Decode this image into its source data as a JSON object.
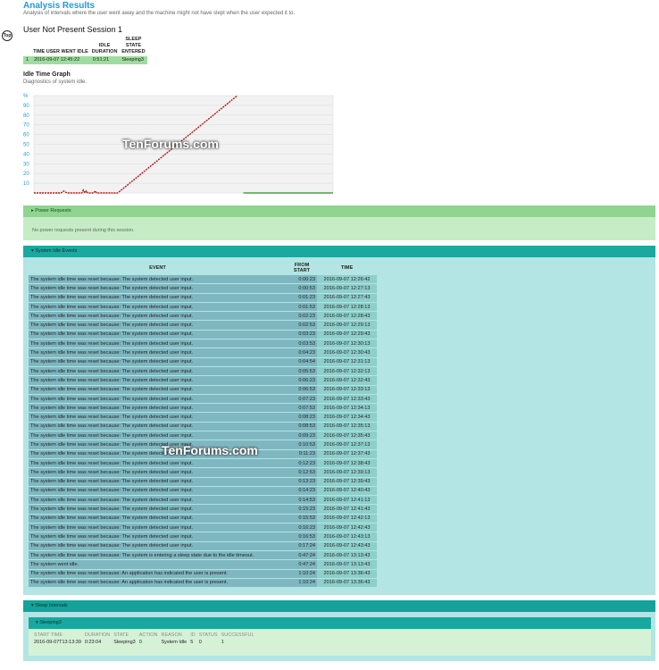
{
  "header": {
    "title": "Analysis Results",
    "subtitle": "Analysis of intervals where the user went away and the machine might not have slept when the user expected it to.",
    "top_button": "Top"
  },
  "session": {
    "title": "User Not Present Session 1",
    "columns": [
      "TIME USER WENT IDLE",
      "IDLE DURATION",
      "SLEEP STATE ENTERED"
    ],
    "row": {
      "index": "1",
      "time": "2016-09-07  12:45:22",
      "duration": "0:51:21",
      "state": "Sleeping3"
    }
  },
  "graph": {
    "title": "Idle Time Graph",
    "subtitle": "Diagnostics of system idle.",
    "y_unit": "%",
    "y_ticks": [
      "90",
      "80",
      "70",
      "60",
      "50",
      "40",
      "30",
      "20",
      "10"
    ]
  },
  "chart_data": {
    "type": "line",
    "ylim": [
      0,
      100
    ],
    "series": [
      {
        "values": [
          [
            0,
            0
          ],
          [
            5,
            0
          ],
          [
            9,
            0
          ],
          [
            10,
            2
          ],
          [
            11,
            0
          ],
          [
            16,
            0
          ],
          [
            16.5,
            3
          ],
          [
            17,
            0
          ],
          [
            17.5,
            2
          ],
          [
            18,
            0
          ],
          [
            20,
            0
          ],
          [
            20.5,
            2
          ],
          [
            21,
            0
          ],
          [
            28,
            0
          ],
          [
            68,
            100
          ]
        ]
      }
    ],
    "xlim": [
      0,
      100
    ],
    "colors": {
      "idle": "#b01818",
      "awake": "#2e8b2e"
    }
  },
  "power": {
    "header": "Power Requests",
    "message": "No power requests present during this session."
  },
  "idle_events": {
    "header": "System Idle Events",
    "columns": [
      "EVENT",
      "FROM START",
      "TIME"
    ],
    "rows": [
      [
        "The system idle time was reset because: The system detected user input.",
        "0:00:23",
        "2016-09-07  12:26:42"
      ],
      [
        "The system idle time was reset because: The system detected user input.",
        "0:00:53",
        "2016-09-07  12:27:13"
      ],
      [
        "The system idle time was reset because: The system detected user input.",
        "0:01:23",
        "2016-09-07  12:27:43"
      ],
      [
        "The system idle time was reset because: The system detected user input.",
        "0:01:53",
        "2016-09-07  12:28:13"
      ],
      [
        "The system idle time was reset because: The system detected user input.",
        "0:02:23",
        "2016-09-07  12:28:43"
      ],
      [
        "The system idle time was reset because: The system detected user input.",
        "0:02:53",
        "2016-09-07  12:29:13"
      ],
      [
        "The system idle time was reset because: The system detected user input.",
        "0:03:23",
        "2016-09-07  12:29:43"
      ],
      [
        "The system idle time was reset because: The system detected user input.",
        "0:03:53",
        "2016-09-07  12:30:13"
      ],
      [
        "The system idle time was reset because: The system detected user input.",
        "0:04:23",
        "2016-09-07  12:30:43"
      ],
      [
        "The system idle time was reset because: The system detected user input.",
        "0:04:54",
        "2016-09-07  12:31:13"
      ],
      [
        "The system idle time was reset because: The system detected user input.",
        "0:05:53",
        "2016-09-07  12:32:13"
      ],
      [
        "The system idle time was reset because: The system detected user input.",
        "0:06:23",
        "2016-09-07  12:32:43"
      ],
      [
        "The system idle time was reset because: The system detected user input.",
        "0:06:53",
        "2016-09-07  12:33:13"
      ],
      [
        "The system idle time was reset because: The system detected user input.",
        "0:07:23",
        "2016-09-07  12:33:43"
      ],
      [
        "The system idle time was reset because: The system detected user input.",
        "0:07:53",
        "2016-09-07  12:34:13"
      ],
      [
        "The system idle time was reset because: The system detected user input.",
        "0:08:23",
        "2016-09-07  12:34:43"
      ],
      [
        "The system idle time was reset because: The system detected user input.",
        "0:08:53",
        "2016-09-07  12:35:13"
      ],
      [
        "The system idle time was reset because: The system detected user input.",
        "0:09:23",
        "2016-09-07  12:35:43"
      ],
      [
        "The system idle time was reset because: The system detected user input.",
        "0:10:53",
        "2016-09-07  12:37:13"
      ],
      [
        "The system idle time was reset because: The system detected user input.",
        "0:11:23",
        "2016-09-07  12:37:43"
      ],
      [
        "The system idle time was reset because: The system detected user input.",
        "0:12:23",
        "2016-09-07  12:38:43"
      ],
      [
        "The system idle time was reset because: The system detected user input.",
        "0:12:53",
        "2016-09-07  12:39:13"
      ],
      [
        "The system idle time was reset because: The system detected user input.",
        "0:13:23",
        "2016-09-07  12:39:43"
      ],
      [
        "The system idle time was reset because: The system detected user input.",
        "0:14:23",
        "2016-09-07  12:40:43"
      ],
      [
        "The system idle time was reset because: The system detected user input.",
        "0:14:53",
        "2016-09-07  12:41:13"
      ],
      [
        "The system idle time was reset because: The system detected user input.",
        "0:15:23",
        "2016-09-07  12:41:43"
      ],
      [
        "The system idle time was reset because: The system detected user input.",
        "0:15:53",
        "2016-09-07  12:42:13"
      ],
      [
        "The system idle time was reset because: The system detected user input.",
        "0:16:23",
        "2016-09-07  12:42:43"
      ],
      [
        "The system idle time was reset because: The system detected user input.",
        "0:16:53",
        "2016-09-07  12:43:13"
      ],
      [
        "The system idle time was reset because: The system detected user input.",
        "0:17:24",
        "2016-09-07  12:43:43"
      ],
      [
        "The system idle time was reset because: The system is entering a sleep state due to the idle timeout.",
        "0:47:24",
        "2016-09-07  13:13:43"
      ],
      [
        "The system went idle.",
        "0:47:24",
        "2016-09-07  13:13:43"
      ],
      [
        "The system idle time was reset because: An application has indicated the user is present.",
        "1:10:24",
        "2016-09-07  13:36:43"
      ],
      [
        "The system idle time was reset because: An application has indicated the user is present.",
        "1:10:24",
        "2016-09-07  13:36:43"
      ]
    ]
  },
  "sleep": {
    "header": "Sleep Intervals",
    "sub_header": "Sleeping3",
    "columns": [
      "START TIME",
      "DURATION",
      "STATE",
      "ACTION",
      "REASON",
      "ID",
      "STATUS",
      "SUCCESSFUL"
    ],
    "row": [
      "2016-09-07T13:13:39",
      "0:23:04",
      "Sleeping3",
      "0",
      "System Idle",
      "5",
      "0",
      "1"
    ]
  },
  "watermark": "TenForums.com"
}
